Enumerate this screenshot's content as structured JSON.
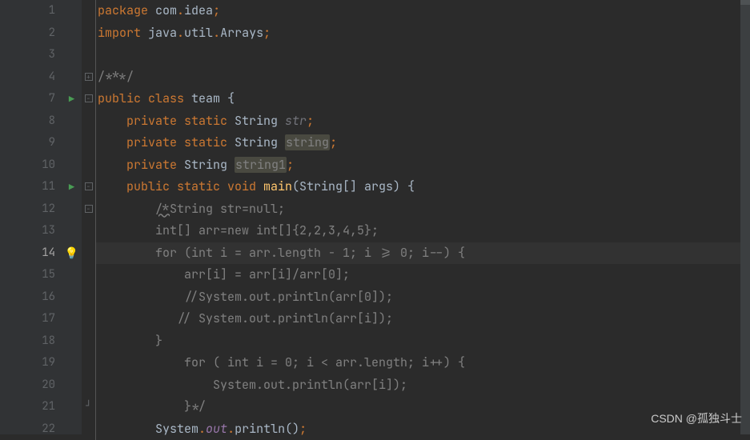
{
  "watermark": "CSDN @孤独斗士",
  "lines": [
    {
      "n": "1",
      "run": "",
      "bulb": "",
      "fold": "",
      "tokens": [
        [
          "kw",
          "package "
        ],
        [
          "id",
          "com"
        ],
        [
          "punc",
          "."
        ],
        [
          "id",
          "idea"
        ],
        [
          "punc",
          ";"
        ]
      ]
    },
    {
      "n": "2",
      "run": "",
      "bulb": "",
      "fold": "",
      "tokens": [
        [
          "kw",
          "import "
        ],
        [
          "id",
          "java"
        ],
        [
          "punc",
          "."
        ],
        [
          "id",
          "util"
        ],
        [
          "punc",
          "."
        ],
        [
          "id",
          "Arrays"
        ],
        [
          "punc",
          ";"
        ]
      ]
    },
    {
      "n": "3",
      "run": "",
      "bulb": "",
      "fold": "",
      "tokens": []
    },
    {
      "n": "4",
      "run": "",
      "bulb": "",
      "fold": "plus",
      "tokens": [
        [
          "comment",
          "/***/"
        ]
      ]
    },
    {
      "n": "7",
      "run": "play",
      "bulb": "",
      "fold": "minus",
      "tokens": [
        [
          "kw",
          "public class "
        ],
        [
          "id",
          "team "
        ],
        [
          "id",
          "{"
        ]
      ]
    },
    {
      "n": "8",
      "run": "",
      "bulb": "",
      "fold": "",
      "tokens": [
        [
          "id",
          "    "
        ],
        [
          "kw",
          "private static "
        ],
        [
          "id",
          "String "
        ],
        [
          "param-it",
          "str"
        ],
        [
          "punc",
          ";"
        ]
      ]
    },
    {
      "n": "9",
      "run": "",
      "bulb": "",
      "fold": "",
      "tokens": [
        [
          "id",
          "    "
        ],
        [
          "kw",
          "private static "
        ],
        [
          "id",
          "String "
        ],
        [
          "hl",
          "string"
        ],
        [
          "punc",
          ";"
        ]
      ]
    },
    {
      "n": "10",
      "run": "",
      "bulb": "",
      "fold": "",
      "tokens": [
        [
          "id",
          "    "
        ],
        [
          "kw",
          "private "
        ],
        [
          "id",
          "String "
        ],
        [
          "hl",
          "string1"
        ],
        [
          "punc",
          ";"
        ]
      ]
    },
    {
      "n": "11",
      "run": "play",
      "bulb": "",
      "fold": "minus",
      "tokens": [
        [
          "id",
          "    "
        ],
        [
          "kw",
          "public static void "
        ],
        [
          "fn",
          "main"
        ],
        [
          "id",
          "(String[] args) {"
        ]
      ]
    },
    {
      "n": "12",
      "run": "",
      "bulb": "",
      "fold": "minus",
      "tokens": [
        [
          "id",
          "        "
        ],
        [
          "comment-u",
          "/*"
        ],
        [
          "comment",
          "String str=null;"
        ]
      ]
    },
    {
      "n": "13",
      "run": "",
      "bulb": "",
      "fold": "",
      "tokens": [
        [
          "id",
          "        "
        ],
        [
          "comment",
          "int[] arr=new int[]{2,2,3,4,5};"
        ]
      ]
    },
    {
      "n": "14",
      "run": "",
      "bulb": "bulb",
      "fold": "",
      "current": true,
      "tokens": [
        [
          "id",
          "        "
        ],
        [
          "comment",
          "for (int i = arr.length - 1; i >= 0; i--) {"
        ]
      ]
    },
    {
      "n": "15",
      "run": "",
      "bulb": "",
      "fold": "",
      "tokens": [
        [
          "id",
          "            "
        ],
        [
          "comment",
          "arr[i] = arr[i]/arr[0];"
        ]
      ]
    },
    {
      "n": "16",
      "run": "",
      "bulb": "",
      "fold": "",
      "tokens": [
        [
          "id",
          "            "
        ],
        [
          "comment",
          "//System.out.println(arr[0]);"
        ]
      ]
    },
    {
      "n": "17",
      "run": "",
      "bulb": "",
      "fold": "",
      "tokens": [
        [
          "id",
          "           "
        ],
        [
          "comment",
          "// System.out.println(arr[i]);"
        ]
      ]
    },
    {
      "n": "18",
      "run": "",
      "bulb": "",
      "fold": "",
      "tokens": [
        [
          "id",
          "        "
        ],
        [
          "comment",
          "}"
        ]
      ]
    },
    {
      "n": "19",
      "run": "",
      "bulb": "",
      "fold": "",
      "tokens": [
        [
          "id",
          "            "
        ],
        [
          "comment",
          "for ( int i = 0; i < arr.length; i++) {"
        ]
      ]
    },
    {
      "n": "20",
      "run": "",
      "bulb": "",
      "fold": "",
      "tokens": [
        [
          "id",
          "                "
        ],
        [
          "comment",
          "System.out.println(arr[i]);"
        ]
      ]
    },
    {
      "n": "21",
      "run": "",
      "bulb": "",
      "fold": "end",
      "tokens": [
        [
          "id",
          "            "
        ],
        [
          "comment",
          "}*/"
        ]
      ]
    },
    {
      "n": "22",
      "run": "",
      "bulb": "",
      "fold": "",
      "tokens": [
        [
          "id",
          "        "
        ],
        [
          "id",
          "System"
        ],
        [
          "punc",
          "."
        ],
        [
          "static-it",
          "out"
        ],
        [
          "punc",
          "."
        ],
        [
          "id",
          "println()"
        ],
        [
          "punc",
          ";"
        ]
      ]
    }
  ]
}
